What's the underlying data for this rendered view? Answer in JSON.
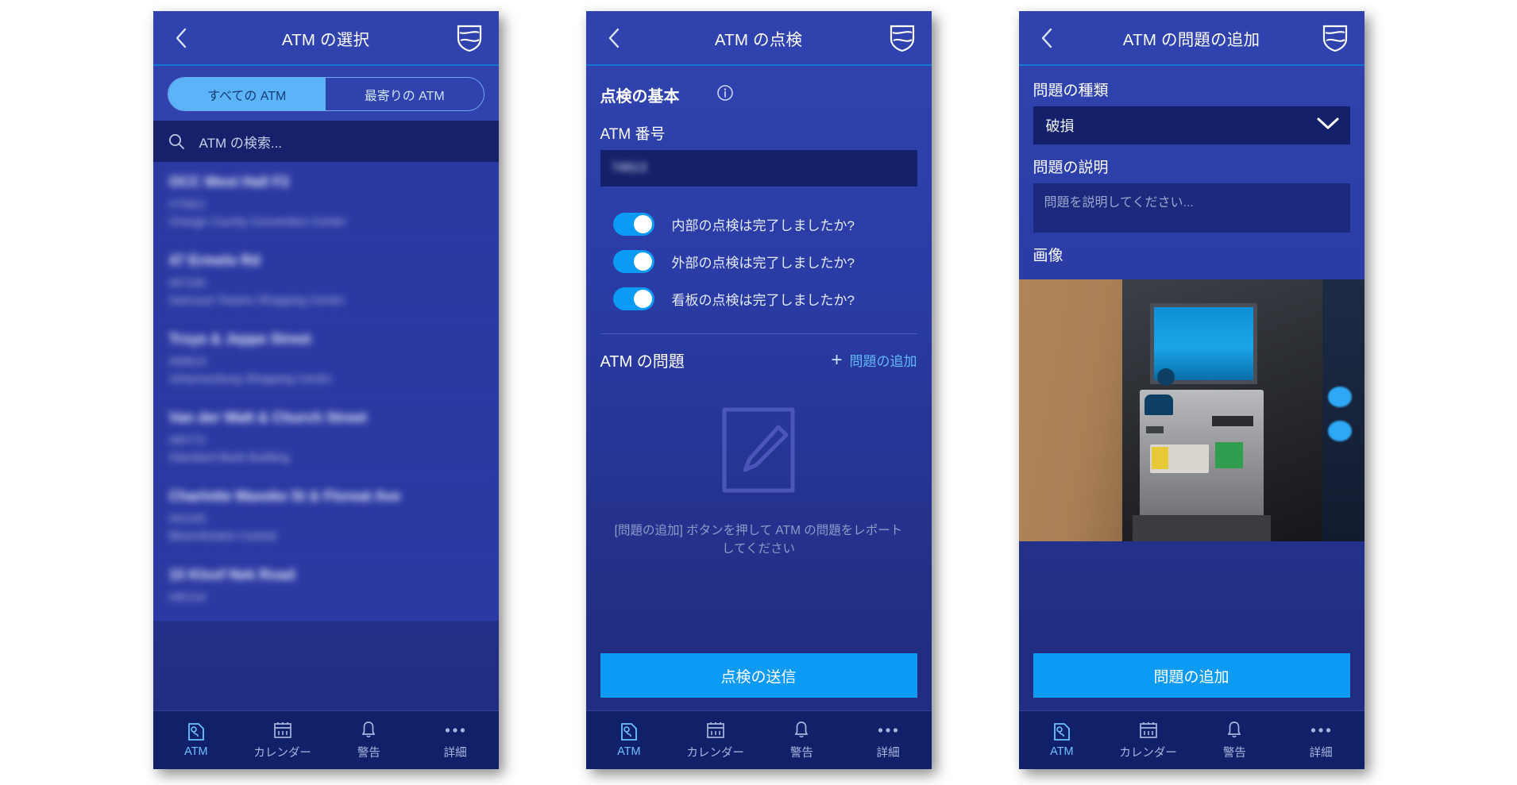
{
  "colors": {
    "brand_blue": "#2f42ad",
    "deep_navy": "#112169",
    "accent_cyan": "#0b9bf5",
    "link_blue": "#63b9f8",
    "field_navy": "#14206a"
  },
  "tabbar": {
    "items": [
      {
        "label": "ATM",
        "icon": "atm-icon",
        "active": true
      },
      {
        "label": "カレンダー",
        "icon": "calendar-icon",
        "active": false
      },
      {
        "label": "警告",
        "icon": "bell-icon",
        "active": false
      },
      {
        "label": "詳細",
        "icon": "more-icon",
        "active": false
      }
    ]
  },
  "panel1": {
    "nav": {
      "title": "ATM の選択",
      "back_icon": "chevron-left-icon",
      "logo_icon": "standard-bank-shield-icon"
    },
    "segment": {
      "options": [
        "すべての ATM",
        "最寄りの ATM"
      ],
      "selected": "すべての ATM"
    },
    "search": {
      "placeholder": "ATM の検索...",
      "icon": "search-icon"
    },
    "atm_list": [
      {
        "name": "OCC West Hall F2",
        "id": "#73821",
        "location": "Orange County Convention Center"
      },
      {
        "name": "47 Ermelo Rd",
        "id": "#87180",
        "location": "Sancourt Towers Shopping Centre"
      },
      {
        "name": "Troye & Jeppe Street",
        "id": "#68819",
        "location": "Johannesburg Shopping Centre"
      },
      {
        "name": "Van der Walt & Church Street",
        "id": "#80772",
        "location": "Standard Bank Building"
      },
      {
        "name": "Charlotte Maxeke St & Floreat Ave",
        "id": "#61035",
        "location": "Bloemfontein Central"
      },
      {
        "name": "15 Kloof Nek Road",
        "id": "#85144",
        "location": ""
      }
    ]
  },
  "panel2": {
    "nav": {
      "title": "ATM の点検",
      "back_icon": "chevron-left-icon",
      "logo_icon": "standard-bank-shield-icon"
    },
    "basics": {
      "heading": "点検の基本",
      "info_icon": "info-icon"
    },
    "atm_number": {
      "label": "ATM 番号",
      "value": "74813"
    },
    "switches": [
      {
        "label": "内部の点検は完了しましたか?",
        "on": true
      },
      {
        "label": "外部の点検は完了しましたか?",
        "on": true
      },
      {
        "label": "看板の点検は完了しましたか?",
        "on": true
      }
    ],
    "problems": {
      "heading": "ATM の問題",
      "add_label": "問題の追加",
      "add_icon": "plus-icon",
      "empty_icon": "note-pencil-icon",
      "empty_text": "[問題の追加] ボタンを押して ATM の問題をレポートしてください"
    },
    "submit_label": "点検の送信"
  },
  "panel3": {
    "nav": {
      "title": "ATM の問題の追加",
      "back_icon": "chevron-left-icon",
      "logo_icon": "standard-bank-shield-icon"
    },
    "problem_type": {
      "label": "問題の種類",
      "value": "破損",
      "chevron_icon": "chevron-down-icon"
    },
    "description": {
      "label": "問題の説明",
      "placeholder": "問題を説明してください..."
    },
    "image": {
      "label": "画像",
      "alt": "atm-photo"
    },
    "submit_label": "問題の追加"
  }
}
